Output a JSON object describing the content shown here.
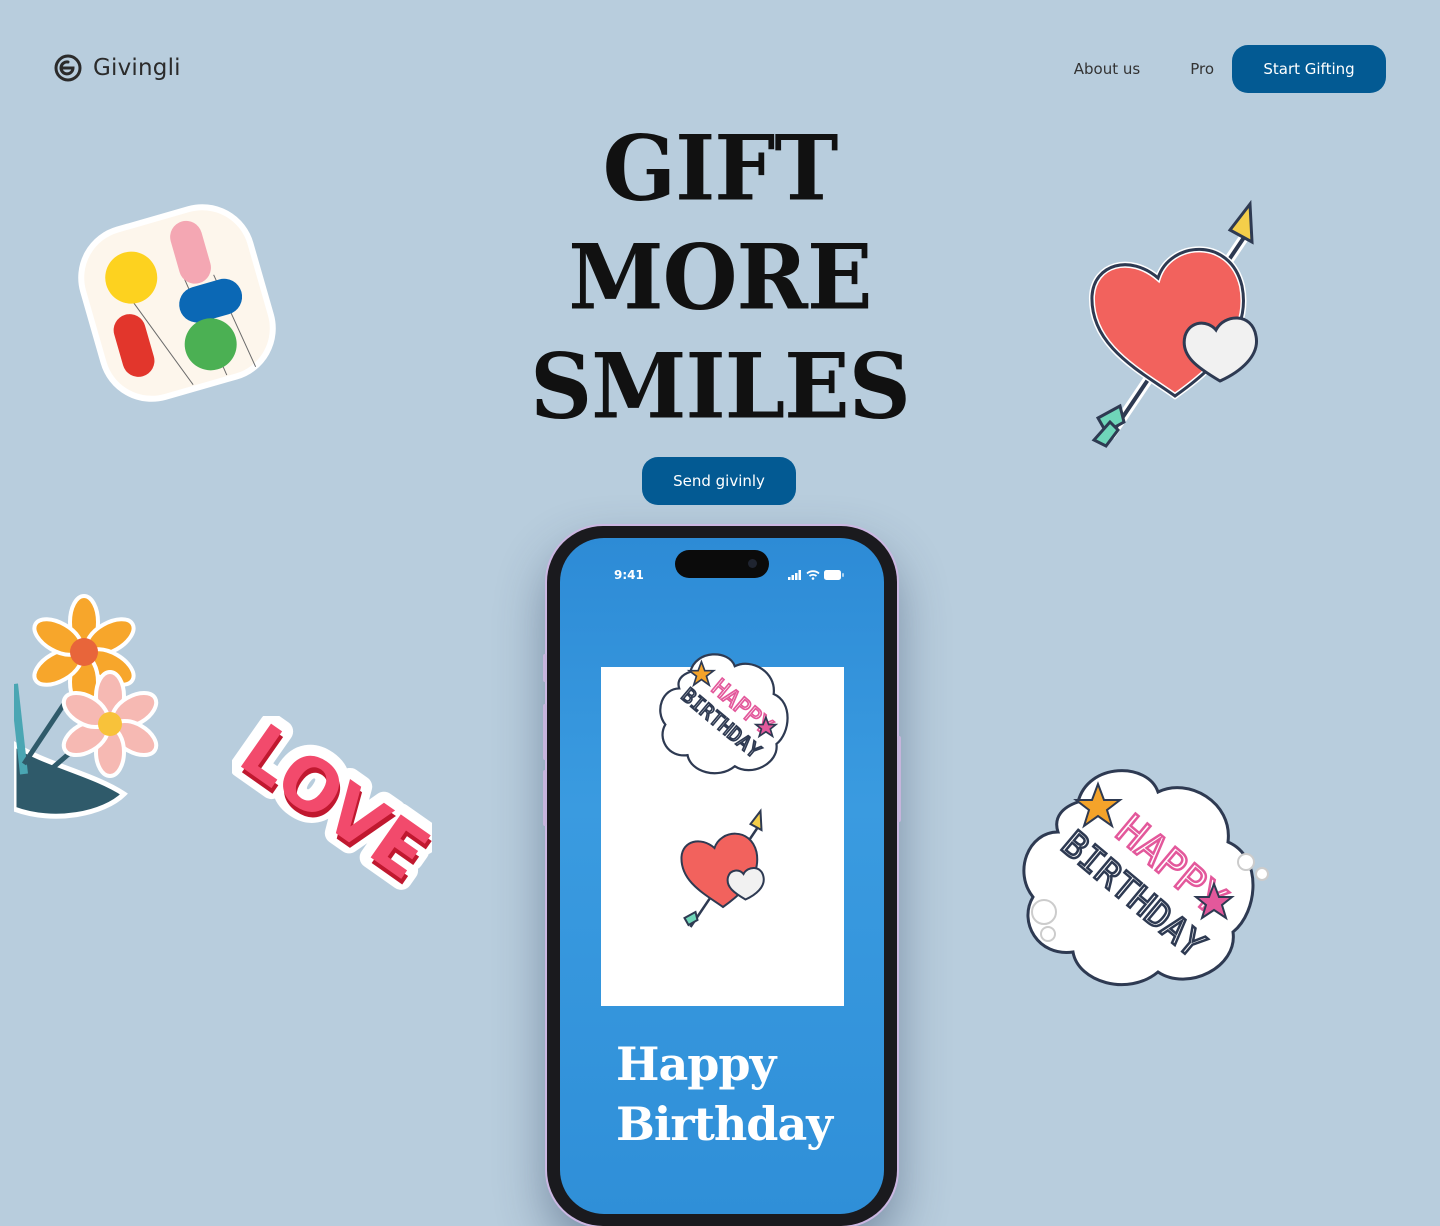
{
  "brand": {
    "name": "Givingli",
    "logo_icon": "givingli-logo-icon"
  },
  "nav": {
    "about": "About us",
    "pro": "Pro",
    "cta": "Start Gifting"
  },
  "hero": {
    "line1": "GIFT",
    "line2": "MORE",
    "line3": "SMILES",
    "cta": "Send givinly"
  },
  "phone": {
    "time": "9:41",
    "card_title_line1": "Happy",
    "card_title_line2": "Birthday",
    "sticker_text": "HAPPY BIRTHDAY"
  },
  "stickers": {
    "love_text": "LOVE",
    "birthday_line1": "HAPPY",
    "birthday_line2": "BIRTHDAY"
  },
  "colors": {
    "background": "#b8cddd",
    "accent": "#035a93",
    "heart": "#f2625d"
  }
}
